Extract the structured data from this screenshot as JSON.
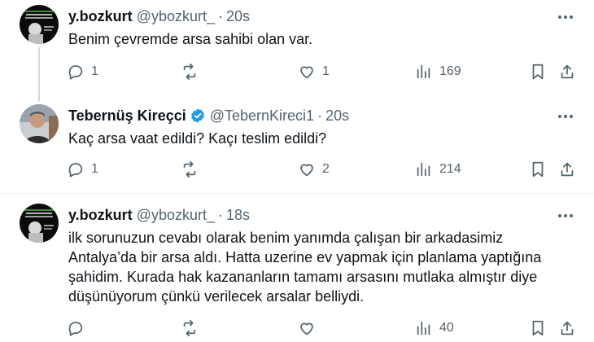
{
  "tweets": [
    {
      "name": "y.bozkurt",
      "handle": "@ybozkurt_",
      "separator": "·",
      "time": "20s",
      "text": "Benim çevremde arsa sahibi olan var.",
      "replies": "1",
      "retweets": "",
      "likes": "1",
      "views": "169"
    },
    {
      "name": "Tebernüş Kireçci",
      "handle": "@TebernKireci1",
      "separator": "·",
      "time": "20s",
      "text": "Kaç arsa vaat edildi? Kaçı teslim edildi?",
      "replies": "1",
      "retweets": "",
      "likes": "2",
      "views": "214",
      "verified": true
    },
    {
      "name": "y.bozkurt",
      "handle": "@ybozkurt_",
      "separator": "·",
      "time": "18s",
      "text_lines": [
        "ilk sorunuzun cevabı olarak benim yanımda çalışan bir arkadasimiz",
        "Antalya’da bir arsa aldı. Hatta uzerine ev yapmak için planlama yaptığına",
        "şahidim. Kurada hak kazananların tamamı arsasını mutlaka almıştır diye",
        "düşünüyorum çünkü verilecek arsalar belliydi."
      ],
      "replies": "",
      "retweets": "",
      "likes": "",
      "views": "40"
    }
  ],
  "icons": {
    "reply": "reply-icon",
    "retweet": "retweet-icon",
    "like": "heart-icon",
    "views": "views-icon",
    "bookmark": "bookmark-icon",
    "share": "share-icon",
    "more": "more-icon",
    "verified": "verified-badge-icon"
  },
  "colors": {
    "text": "#0f1419",
    "secondary": "#536471",
    "verified": "#1d9bf0",
    "thread_line": "#cfd9de"
  }
}
